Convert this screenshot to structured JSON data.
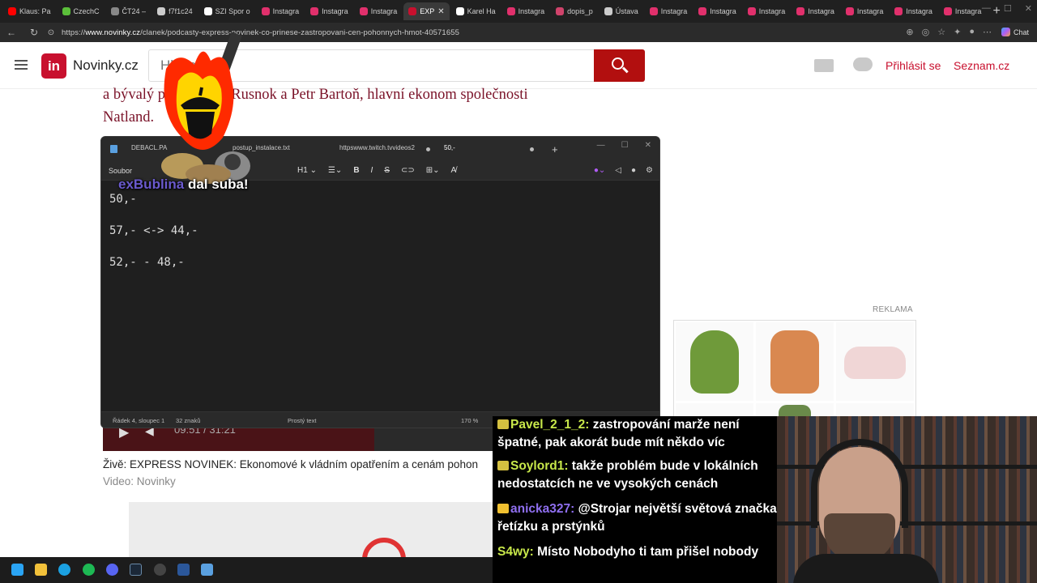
{
  "browser": {
    "tabs": [
      {
        "label": "Klaus: Pa",
        "color": "#ff0000",
        "active": false
      },
      {
        "label": "CzechC",
        "color": "#5bbf3a",
        "active": false
      },
      {
        "label": "ČT24 –",
        "color": "#888888",
        "active": false
      },
      {
        "label": "f7f1c24",
        "color": "#cccccc",
        "active": false
      },
      {
        "label": "SZI Spor o",
        "color": "#ffffff",
        "active": false
      },
      {
        "label": "Instagra",
        "color": "#e1306c",
        "active": false
      },
      {
        "label": "Instagra",
        "color": "#e1306c",
        "active": false
      },
      {
        "label": "Instagra",
        "color": "#e1306c",
        "active": false
      },
      {
        "label": "EXP",
        "color": "#c8102e",
        "active": true
      },
      {
        "label": "Karel Ha",
        "color": "#ffffff",
        "active": false
      },
      {
        "label": "Instagra",
        "color": "#e1306c",
        "active": false
      },
      {
        "label": "dopis_p",
        "color": "#d0436b",
        "active": false
      },
      {
        "label": "Ústava",
        "color": "#cccccc",
        "active": false
      },
      {
        "label": "Instagra",
        "color": "#e1306c",
        "active": false
      },
      {
        "label": "Instagra",
        "color": "#e1306c",
        "active": false
      },
      {
        "label": "Instagra",
        "color": "#e1306c",
        "active": false
      },
      {
        "label": "Instagra",
        "color": "#e1306c",
        "active": false
      },
      {
        "label": "Instagra",
        "color": "#e1306c",
        "active": false
      },
      {
        "label": "Instagra",
        "color": "#e1306c",
        "active": false
      },
      {
        "label": "Instagra",
        "color": "#e1306c",
        "active": false
      }
    ],
    "url_prefix": "https://",
    "url_domain": "www.novinky.cz",
    "url_path": "/clanek/podcasty-express-novinek-co-prinese-zastropovani-cen-pohonnych-hmot-40571655",
    "chat_label": "Chat"
  },
  "site": {
    "logo_mark": "in",
    "logo_text": "Novinky.cz",
    "search_placeholder": "Hledat",
    "login_label": "Přihlásit se",
    "seznam_label": "Seznam.cz"
  },
  "article": {
    "line1": "a bývalý premiér Jiří Rusnok a Petr Bartoň, hlavní ekonom společnosti",
    "line2": "Natland.",
    "player_time": "09:51 / 31:21",
    "caption": "Živě: EXPRESS NOVINEK: Ekonomové k vládním opatřením a cenám pohon",
    "caption_source": "Video: Novinky"
  },
  "ad": {
    "label": "REKLAMA"
  },
  "notepad": {
    "tab1": "DEBACL.PA",
    "tab2": "postup_instalace.txt",
    "tab3": "httpswww.twitch.tvvideos2",
    "tab4": "50,-",
    "menu_file": "Soubor",
    "heading_label": "H1",
    "lines": [
      "50,-",
      "57,- <-> 44,-",
      "52,- - 48,-"
    ],
    "status_position": "Řádek 4, sloupec 1",
    "status_chars": "32 znaků",
    "status_format": "Prostý text",
    "status_zoom": "170 %"
  },
  "alert": {
    "name": "exBublina",
    "text": " dal suba!"
  },
  "chat": [
    {
      "user": "Pavel_2_1_2",
      "color": "#c8e84a",
      "text": "zastropování marže není špatné, pak akorát bude mít někdo víc"
    },
    {
      "user": "Soylord1",
      "color": "#c8e84a",
      "text": "takže problém bude v lokálních nedostatcích ne ve vysokých cenách"
    },
    {
      "user": "anicka327",
      "color": "#8f6ff0",
      "text": "@Strojar největší světová značka řetízku a prstýnků"
    },
    {
      "user": "S4wy",
      "color": "#c8e84a",
      "text": "Místo Nobodyho ti tam přišel nobody"
    }
  ]
}
